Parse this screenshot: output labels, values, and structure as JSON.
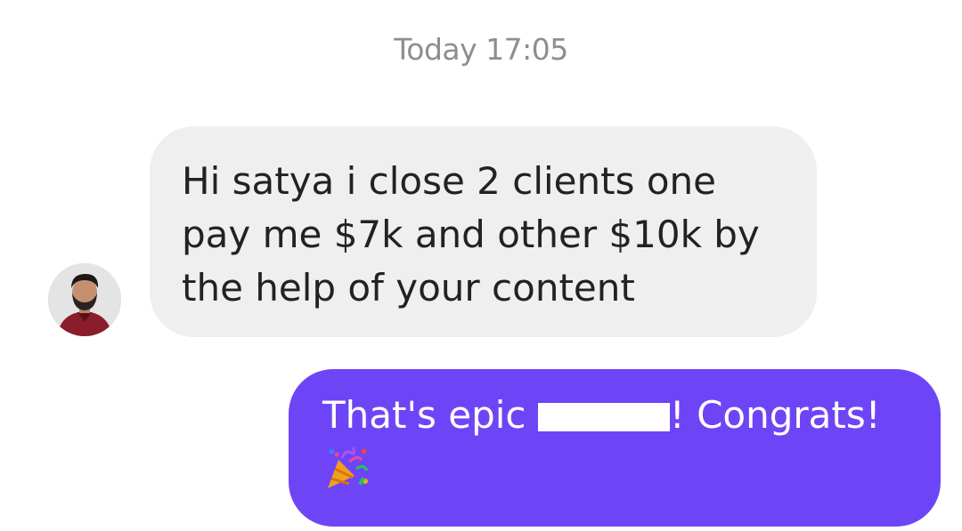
{
  "header": {
    "timestamp": "Today 17:05"
  },
  "messages": [
    {
      "direction": "incoming",
      "text": "Hi satya i close 2 clients one pay me $7k and other $10k by the help of your content"
    },
    {
      "direction": "outgoing",
      "text_before": "That's epic ",
      "text_after": "! Congrats!",
      "emoji": "party-popper"
    }
  ],
  "colors": {
    "incoming_bubble": "#efefef",
    "outgoing_bubble": "#6e45f6",
    "timestamp": "#8e8e8e"
  }
}
